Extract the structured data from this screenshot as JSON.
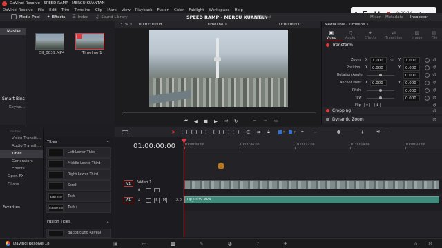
{
  "titlebar": {
    "app": "DaVinci Resolve - SPEED RAMP - MERCU KUANTAN"
  },
  "menu": [
    "DaVinci Resolve",
    "File",
    "Edit",
    "Trim",
    "Timeline",
    "Clip",
    "Mark",
    "View",
    "Playback",
    "Fusion",
    "Color",
    "Fairlight",
    "Workspace",
    "Help"
  ],
  "recorder": {
    "time": "0:00:14"
  },
  "toolbar": {
    "media_pool": "Media Pool",
    "effects": "Effects",
    "index": "Index",
    "sound_library": "Sound Library",
    "project_title": "SPEED RAMP - MERCU KUANTAN",
    "edited": "Edited",
    "mixer": "Mixer",
    "metadata": "Metadata",
    "inspector": "Inspector"
  },
  "media_pool": {
    "master": "Master",
    "smart_bins": "Smart Bins",
    "keywords": "Keywo...",
    "clips": [
      {
        "name": "DJI_0039.MP4"
      },
      {
        "name": "Timeline 1"
      }
    ]
  },
  "viewer": {
    "zoom": "31%",
    "source_tc": "00:02:10:08",
    "timeline_name": "Timeline 1",
    "record_tc": "01:00:00:00"
  },
  "inspector": {
    "header": "Media Pool - Timeline 1",
    "tabs": [
      "Video",
      "Audio",
      "Effects",
      "Transition",
      "Image",
      "File"
    ],
    "transform": "Transform",
    "zoom_label": "Zoom",
    "zoom_x": "1.000",
    "zoom_y": "1.000",
    "position_label": "Position",
    "position_x": "0.000",
    "position_y": "0.000",
    "rotation_label": "Rotation Angle",
    "rotation": "0.000",
    "anchor_label": "Anchor Point",
    "anchor_x": "0.000",
    "anchor_y": "0.000",
    "pitch_label": "Pitch",
    "pitch": "0.000",
    "yaw_label": "Yaw",
    "yaw": "0.000",
    "flip_label": "Flip",
    "x": "X",
    "y": "Y",
    "cropping": "Cropping",
    "dynamic_zoom": "Dynamic Zoom"
  },
  "effects_library": {
    "toolbox_label": "Toolbox",
    "tree": [
      "Video Transiti...",
      "Audio Transiti...",
      "Titles",
      "Generators",
      "Effects",
      "Open FX",
      "Filters"
    ],
    "favorites": "Favorites",
    "titles_header": "Titles",
    "title_items": [
      {
        "thumb": "",
        "name": "Left Lower Third"
      },
      {
        "thumb": "",
        "name": "Middle Lower Third"
      },
      {
        "thumb": "",
        "name": "Right Lower Third"
      },
      {
        "thumb": "",
        "name": "Scroll"
      },
      {
        "thumb": "Basic Title",
        "name": "Text"
      },
      {
        "thumb": "Custom Title",
        "name": "Text+"
      }
    ],
    "fusion_header": "Fusion Titles",
    "fusion_items": [
      {
        "name": "Background Reveal"
      }
    ]
  },
  "timeline": {
    "timecode": "01:00:00:00",
    "ruler": [
      "01:00:00:00",
      "01:00:06:00",
      "01:00:12:00",
      "01:00:18:00",
      "01:00:24:00",
      "01:00:30:00",
      "01:00:36:00"
    ],
    "video_track_id": "V1",
    "video_track_name": "Video 1",
    "audio_track_id": "A1",
    "audio_level": "2.0",
    "s": "S",
    "m": "M",
    "audio_clip": "DJI_0039.MP4"
  },
  "bottom": {
    "app_label": "DaVinci Resolve 18"
  },
  "colors": {
    "accent_red": "#e0383c",
    "blue": "#2f6fd8",
    "audio_green": "#3f8a7a"
  }
}
